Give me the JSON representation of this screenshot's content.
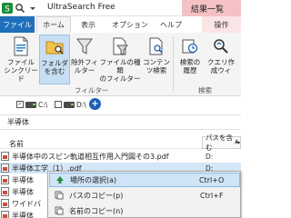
{
  "window": {
    "title": "UltraSearch Free",
    "context_tab": "結果一覧"
  },
  "ribbon_tabs": {
    "file": "ファイル",
    "home": "ホーム",
    "view": "表示",
    "options": "オプション",
    "help": "ヘルプ",
    "operations": "操作"
  },
  "ribbon": {
    "file_link": "ファイル\nシンクリード",
    "folder_include": "フォルダ\nを含む",
    "exclude_filter": "除外フィ\nルター",
    "file_type_filter": "ファイルの種類\nのフィルター",
    "content_search": "コンテン\nツ検索",
    "filter_group": "フィルター",
    "search_history": "検索の\n履歴",
    "query_settings": "クエリ作\n成ウィ",
    "search_group": "検索"
  },
  "drives": [
    {
      "label": "C:\\",
      "checked": true
    },
    {
      "label": "D:\\",
      "checked": false
    }
  ],
  "search": {
    "value": "半導体"
  },
  "file_list": {
    "col_name": "名前",
    "col_path": "パスを含む",
    "rows": [
      {
        "name": "半導体中のスピン軌道相互作用入門図その3.pdf",
        "path": "D:",
        "selected": false
      },
      {
        "name": "半導体工学（1）.pdf",
        "path": "D:",
        "selected": true
      },
      {
        "name": "半導体",
        "path": "",
        "selected": false
      },
      {
        "name": "半導体",
        "path": "",
        "selected": false
      },
      {
        "name": "ワイドバ",
        "path": "",
        "selected": false
      },
      {
        "name": "半導体",
        "path": "",
        "selected": false
      }
    ]
  },
  "context_menu": {
    "items": [
      {
        "label": "場所の選択(a)",
        "shortcut": "Ctrl+O",
        "highlighted": true
      },
      {
        "label": "パスのコピー(p)",
        "shortcut": "Ctrl+F",
        "highlighted": false
      },
      {
        "label": "名前のコピー(n)",
        "shortcut": "",
        "highlighted": false
      }
    ]
  },
  "colors": {
    "file_tab": "#1f6fba",
    "context_tab": "#f4c2c5",
    "selection": "#cfe4f6"
  }
}
